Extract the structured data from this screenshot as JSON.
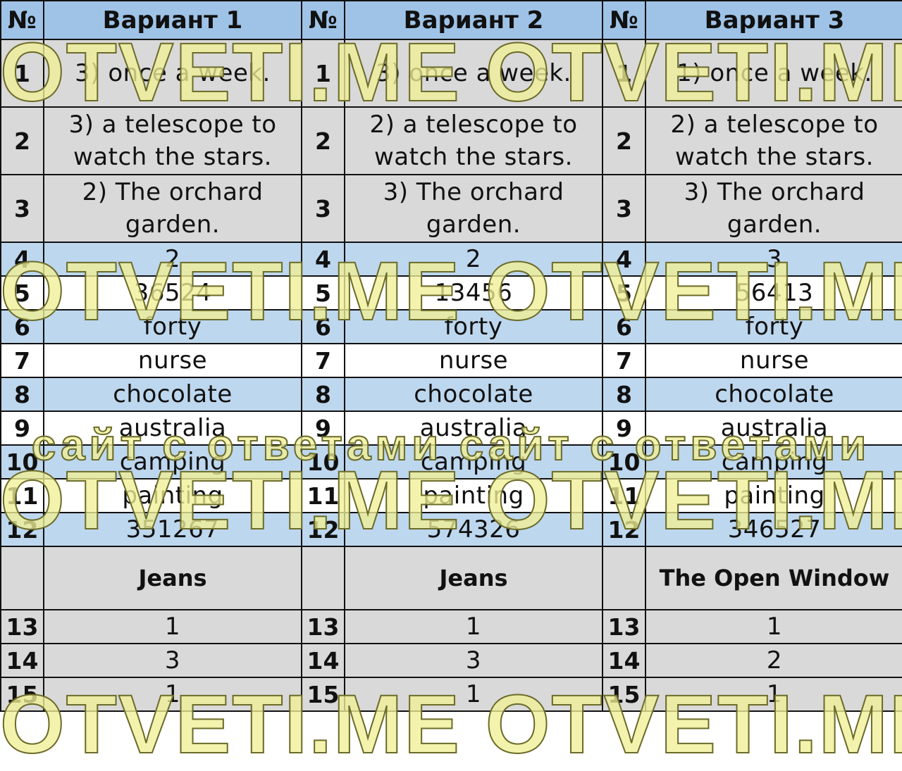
{
  "header": {
    "num_label": "№",
    "variants": [
      "Вариант 1",
      "Вариант 2",
      "Вариант 3"
    ]
  },
  "rows": [
    {
      "num": "1",
      "answers": [
        "3) once a week.",
        "3) once a week.",
        "1) once a week."
      ]
    },
    {
      "num": "2",
      "answers": [
        "3) a telescope to watch the stars.",
        "2) a telescope to watch the stars.",
        "2) a telescope to watch the stars."
      ]
    },
    {
      "num": "3",
      "answers": [
        "2) The orchard garden.",
        "3) The orchard garden.",
        "3) The orchard garden."
      ]
    },
    {
      "num": "4",
      "answers": [
        "2",
        "2",
        "3"
      ]
    },
    {
      "num": "5",
      "answers": [
        "36524",
        "13456",
        "56413"
      ]
    },
    {
      "num": "6",
      "answers": [
        "forty",
        "forty",
        "forty"
      ]
    },
    {
      "num": "7",
      "answers": [
        "nurse",
        "nurse",
        "nurse"
      ]
    },
    {
      "num": "8",
      "answers": [
        "chocolate",
        "chocolate",
        "chocolate"
      ]
    },
    {
      "num": "9",
      "answers": [
        "australia",
        "australia",
        "australia"
      ]
    },
    {
      "num": "10",
      "answers": [
        "camping",
        "camping",
        "camping"
      ]
    },
    {
      "num": "11",
      "answers": [
        "painting",
        "painting",
        "painting"
      ]
    },
    {
      "num": "12",
      "answers": [
        "351267",
        "574326",
        "346527"
      ]
    }
  ],
  "section_titles": [
    "Jeans",
    "Jeans",
    "The Open Window"
  ],
  "rows2": [
    {
      "num": "13",
      "answers": [
        "1",
        "1",
        "1"
      ]
    },
    {
      "num": "14",
      "answers": [
        "3",
        "3",
        "2"
      ]
    },
    {
      "num": "15",
      "answers": [
        "1",
        "1",
        "1"
      ]
    }
  ],
  "watermark": {
    "big": "OTVETI.ME OTVETI.ME",
    "small": "сайт с ответами  сайт с ответами"
  },
  "colors": {
    "header_bg": "#9fc3e7",
    "blue_row": "#bdd7ee",
    "grey_row": "#d9d9d9",
    "white_row": "#ffffff"
  }
}
